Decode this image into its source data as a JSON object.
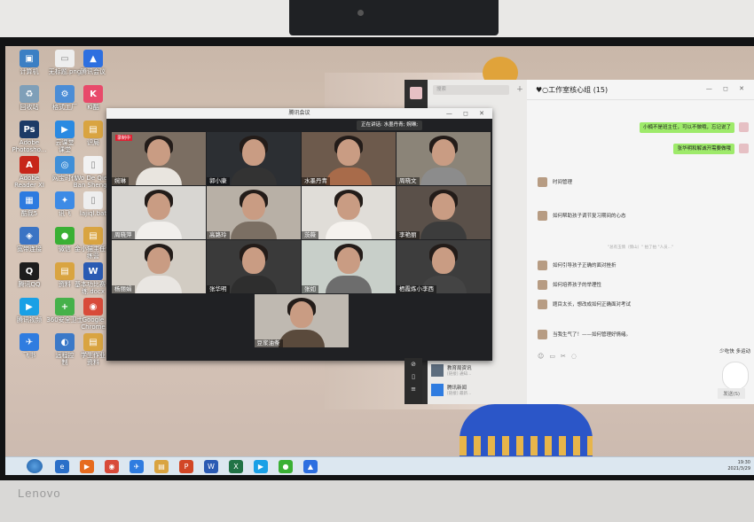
{
  "desktop_icons": [
    {
      "id": "computer",
      "label": "计算机",
      "color": "#3b7fc4",
      "glyph": "▣"
    },
    {
      "id": "file",
      "label": "无标题.png",
      "color": "#eeeeee",
      "glyph": "▭"
    },
    {
      "id": "tencent-meeting",
      "label": "腾讯会议",
      "color": "#2d6fe0",
      "glyph": "▲"
    },
    {
      "id": "recycle",
      "label": "回收站",
      "color": "#7f9fb8",
      "glyph": "♻"
    },
    {
      "id": "format-factory",
      "label": "格式工厂",
      "color": "#4b8dd6",
      "glyph": "⚙"
    },
    {
      "id": "office",
      "label": "Ki酷",
      "color": "#e84a6a",
      "glyph": "K"
    },
    {
      "id": "photoshop",
      "label": "Adobe\nPhotosho...",
      "color": "#1c3a66",
      "glyph": "Ps"
    },
    {
      "id": "tencent-video",
      "label": "云课堂\n课堂",
      "color": "#2a8ae2",
      "glyph": "▶"
    },
    {
      "id": "folder1",
      "label": "识局",
      "color": "#d9a441",
      "glyph": "▤"
    },
    {
      "id": "acrobat",
      "label": "Adobe\nReader XI",
      "color": "#c7261a",
      "glyph": "A"
    },
    {
      "id": "network",
      "label": "网宝时代",
      "color": "#3f8fd8",
      "glyph": "◎"
    },
    {
      "id": "doc1",
      "label": "Wo De Qien\nBan Sheng...",
      "color": "#f2f2f2",
      "glyph": "▯"
    },
    {
      "id": "apps",
      "label": "酷我5",
      "color": "#2d7be0",
      "glyph": "▦"
    },
    {
      "id": "pigeon",
      "label": "讯飞",
      "color": "#3d8be6",
      "glyph": "✦"
    },
    {
      "id": "bat",
      "label": "lajiql.bat",
      "color": "#eeeeee",
      "glyph": "▯"
    },
    {
      "id": "network2",
      "label": "宽带连接",
      "color": "#3b74c4",
      "glyph": "◈"
    },
    {
      "id": "wechat",
      "label": "微信",
      "color": "#3ab034",
      "glyph": "●"
    },
    {
      "id": "folder2",
      "label": "金小猫主任训\n练营",
      "color": "#d9a441",
      "glyph": "▤"
    },
    {
      "id": "qq",
      "label": "腾讯QQ",
      "color": "#1d1d1d",
      "glyph": "Q"
    },
    {
      "id": "folder3",
      "label": "资料",
      "color": "#d9a441",
      "glyph": "▤"
    },
    {
      "id": "word",
      "label": "基本功比赛训\n练.docx",
      "color": "#2b5bb3",
      "glyph": "W"
    },
    {
      "id": "video-player",
      "label": "腾讯视频",
      "color": "#19a0e6",
      "glyph": "▶"
    },
    {
      "id": "security",
      "label": "360安全卫士",
      "color": "#46b14a",
      "glyph": "+"
    },
    {
      "id": "chrome",
      "label": "Google\nChrome",
      "color": "#d84b3a",
      "glyph": "◉"
    },
    {
      "id": "feishu",
      "label": "飞书",
      "color": "#2f7ce0",
      "glyph": "✈"
    },
    {
      "id": "remote",
      "label": "远程控\n制",
      "color": "#3b79c8",
      "glyph": "◐"
    },
    {
      "id": "folder4",
      "label": "学生作业\n资料",
      "color": "#d9a441",
      "glyph": "▤"
    }
  ],
  "meeting": {
    "window_title": "腾讯会议",
    "window_controls": "— ◻ ✕",
    "speaking_label": "正在讲话: 水墨丹青; 婉琳;",
    "recording_label": "录制中",
    "participants": [
      {
        "name": "婉琳",
        "bg": "#7b6e62"
      },
      {
        "name": "郭小康",
        "bg": "#2c2f33"
      },
      {
        "name": "水墨丹青",
        "bg": "#6d5a4c"
      },
      {
        "name": "周晓文",
        "bg": "#8b8478"
      },
      {
        "name": "周晓萍",
        "bg": "#d8d6d2"
      },
      {
        "name": "高路玲",
        "bg": "#b8b0a6"
      },
      {
        "name": "茨薇",
        "bg": "#e0ddd8"
      },
      {
        "name": "李艳丽",
        "bg": "#5a5049"
      },
      {
        "name": "杨丽娟",
        "bg": "#d2ccc3"
      },
      {
        "name": "张华明",
        "bg": "#3a3a3a"
      },
      {
        "name": "张如",
        "bg": "#c8cfc9"
      },
      {
        "name": "栖霞炼小李西",
        "bg": "#3d3d3d"
      },
      {
        "name": "豆浆油条",
        "bg": "#bfb9b1"
      }
    ]
  },
  "wechat": {
    "chat_title": "♥○工作室核心组 (15)",
    "window_controls": "— ◻ ✕",
    "search_placeholder": "搜索",
    "messages_right": [
      "小楠不是班主任，可以不做哦，忘记说了",
      "张华明和解诚开需要做哦"
    ],
    "messages_left": [
      "时间管理",
      "如何帮助孩子调节复习期间的心态",
      "如何引导孩子正确的面对挫折",
      "如何培养孩子的举理性",
      "题目太长，想改成如何正确面对考试",
      "当我生气了！——如何管理好情绪。"
    ],
    "system_notice": "\"总有玉情（情山）\" 拍了拍 \"人员...\"",
    "list_items": [
      {
        "name": "教育局资讯",
        "preview": "[链接] 通知…",
        "color": "#5d6d7e"
      },
      {
        "name": "腾讯新闻",
        "preview": "[链接] 最新…",
        "color": "#2f7ce0"
      }
    ],
    "sticker_text": "少吃快 多运动",
    "send_label": "发送(S)"
  },
  "taskbar": {
    "items": [
      {
        "id": "ie",
        "color": "#2b6fc8",
        "glyph": "e"
      },
      {
        "id": "media",
        "color": "#e66b1e",
        "glyph": "▶"
      },
      {
        "id": "chrome",
        "color": "#d84b3a",
        "glyph": "◉"
      },
      {
        "id": "feishu",
        "color": "#2f7ce0",
        "glyph": "✈"
      },
      {
        "id": "explorer",
        "color": "#d9a441",
        "glyph": "▤"
      },
      {
        "id": "ppt",
        "color": "#d24726",
        "glyph": "P"
      },
      {
        "id": "word",
        "color": "#2b5bb3",
        "glyph": "W"
      },
      {
        "id": "excel",
        "color": "#217346",
        "glyph": "X"
      },
      {
        "id": "video",
        "color": "#19a0e6",
        "glyph": "▶"
      },
      {
        "id": "wechat",
        "color": "#3ab034",
        "glyph": "●"
      },
      {
        "id": "meeting",
        "color": "#2d6fe0",
        "glyph": "▲"
      }
    ],
    "time": "19:30",
    "date": "2021/3/29"
  },
  "monitor_brand": "Lenovo"
}
